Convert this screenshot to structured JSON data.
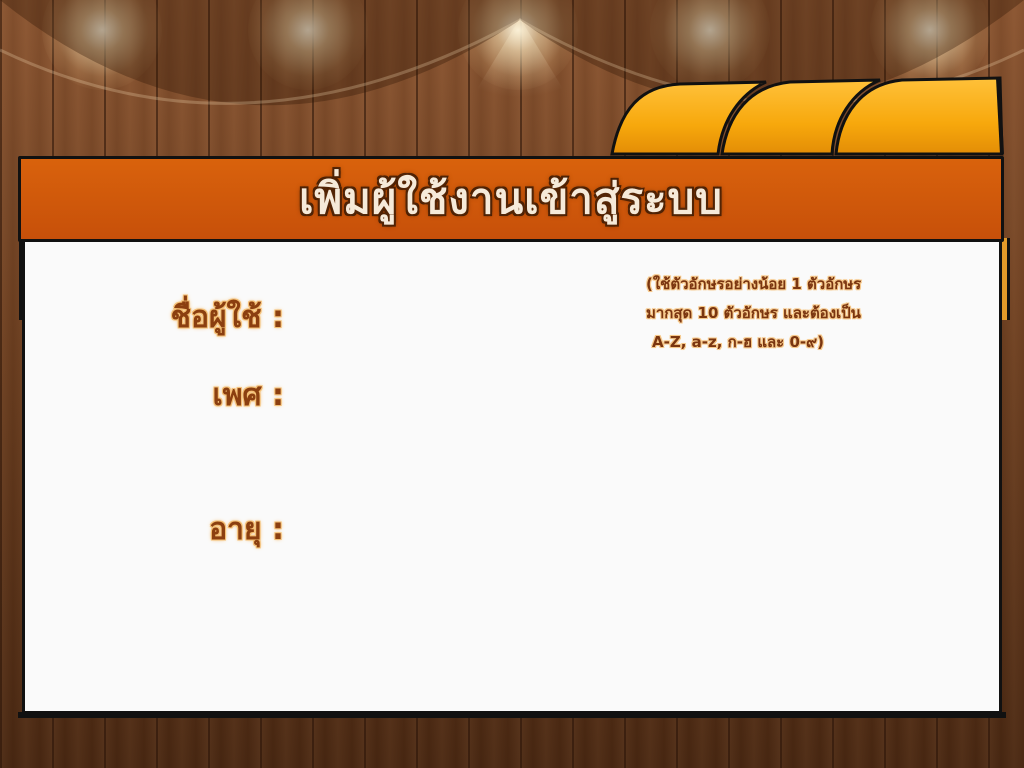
{
  "screen": {
    "title": "เพิ่มผู้ใช้งานเข้าสู่ระบบ"
  },
  "form": {
    "username_label": "ชื่อผู้ใช้ :",
    "gender_label": "เพศ :",
    "age_label": "อายุ :"
  },
  "hint": {
    "line1": "(ใช้ตัวอักษรอย่างน้อย 1 ตัวอักษร",
    "line2": "มากสุด 10 ตัวอักษร และต้องเป็น",
    "line3": "A-Z, a-z, ก-ฮ และ 0-๙)"
  },
  "colors": {
    "title_bar": "#c7500a",
    "title_text": "#f6ead9",
    "label_text": "#8b3f10",
    "panel": "#fafafa",
    "awning": "#f7a80c",
    "wood": "#6d3f20"
  },
  "decor": {
    "background": "wood-plank-wall",
    "lights": "stage-spotlight-icons",
    "awning": "awning-icon"
  }
}
